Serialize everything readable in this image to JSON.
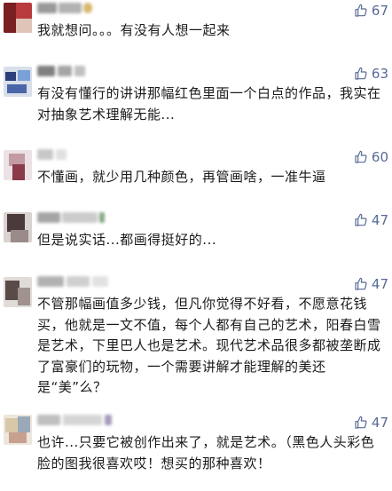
{
  "comments": [
    {
      "likes": "67",
      "text": "我就想问。。。有没有人想一起来",
      "avatar_colors": [
        "#7a1f22",
        "#b83a3c",
        "#e0c4b8"
      ],
      "name_colors": [
        "#777777",
        "#999999",
        "#c9a23c"
      ]
    },
    {
      "likes": "63",
      "text": "有没有懂行的讲讲那幅红色里面一个白点的作品，我实在对抽象艺术理解无能...",
      "avatar_colors": [
        "#2d3e7a",
        "#7aa0d8",
        "#d8dfe9"
      ],
      "name_colors": [
        "#555555",
        "#888888",
        "#aaaaaa"
      ]
    },
    {
      "likes": "60",
      "text": "不懂画，就少用几种颜色，再管画啥，一准牛逼",
      "avatar_colors": [
        "#c49aa5",
        "#8a3a4a",
        "#ece1e4"
      ],
      "name_colors": [
        "#b5b5b5",
        "#d5d5d5"
      ]
    },
    {
      "likes": "47",
      "text": "但是说实话...都画得挺好的...",
      "avatar_colors": [
        "#4a3a3c",
        "#9a8a88",
        "#d8d2d0"
      ],
      "name_colors": [
        "#888888",
        "#bbbbbb",
        "#5f8a5f"
      ]
    },
    {
      "likes": "47",
      "text": "不管那幅画值多少钱，但凡你觉得不好看，不愿意花钱买，他就是一文不值，每个人都有自己的艺术，阳春白雪是艺术，下里巴人也是艺术。现代艺术品很多都被垄断成了富豪们的玩物，一个需要讲解才能理解的美还是“美”么？",
      "avatar_colors": [
        "#5a4a48",
        "#a0928c",
        "#e0dcd8"
      ],
      "name_colors": [
        "#999999",
        "#c0c0c0",
        "#d8d8d8"
      ]
    },
    {
      "likes": "47",
      "text": "也许...只要它被创作出来了，就是艺术。（黑色人头彩色脸的图我很喜欢哎！想买的那种喜欢！",
      "avatar_colors": [
        "#d8c8a8",
        "#9aa8b8",
        "#c8a090"
      ],
      "name_colors": [
        "#aaaaaa",
        "#c8c8c8",
        "#8a7aa8"
      ]
    }
  ]
}
